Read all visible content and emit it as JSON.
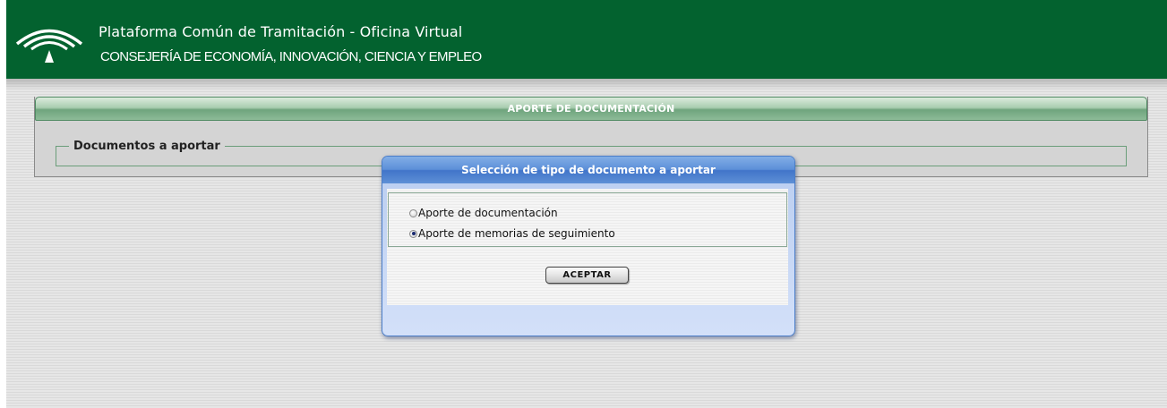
{
  "header": {
    "title": "Plataforma Común de Tramitación - Oficina Virtual",
    "subtitle": "CONSEJERÍA DE ECONOMÍA, INNOVACIÓN, CIENCIA Y EMPLEO",
    "logo_icon": "junta-andalucia-logo"
  },
  "panel": {
    "title": "APORTE DE DOCUMENTACIÓN",
    "fieldset_legend": "Documentos a aportar"
  },
  "modal": {
    "title": "Selección de tipo de documento a aportar",
    "options": [
      {
        "label": "Aporte de documentación",
        "checked": false
      },
      {
        "label": "Aporte de memorias de seguimiento",
        "checked": true
      }
    ],
    "accept_label": "ACEPTAR"
  },
  "colors": {
    "header_green": "#03622f",
    "modal_blue": "#4174c9",
    "panel_header_green": "#6fa47d"
  }
}
